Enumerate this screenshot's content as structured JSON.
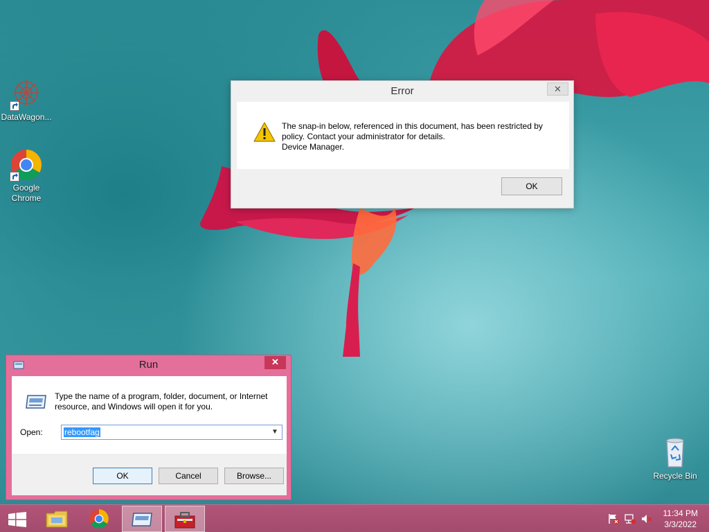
{
  "desktop": {
    "icons": [
      {
        "label": "DataWagon...",
        "icon": "datawagon-icon"
      },
      {
        "label": "Google Chrome",
        "icon": "chrome-icon"
      },
      {
        "label": "Recycle Bin",
        "icon": "recycle-bin-icon"
      }
    ]
  },
  "error_dialog": {
    "title": "Error",
    "close": "✕",
    "message_line1": "The snap-in below, referenced in this document, has been restricted by",
    "message_line2": "policy. Contact your administrator for details.",
    "message_line3": "Device Manager.",
    "ok_label": "OK",
    "icon": "warning-icon"
  },
  "run_dialog": {
    "title": "Run",
    "close": "✕",
    "description": "Type the name of a program, folder, document, or Internet resource, and Windows will open it for you.",
    "open_label": "Open:",
    "open_value": "rebootfag",
    "ok_label": "OK",
    "cancel_label": "Cancel",
    "browse_label": "Browse..."
  },
  "taskbar": {
    "items": [
      {
        "icon": "windows-logo-icon",
        "name": "start"
      },
      {
        "icon": "file-explorer-icon",
        "name": "File Explorer"
      },
      {
        "icon": "chrome-icon",
        "name": "Google Chrome"
      },
      {
        "icon": "run-icon",
        "name": "Run",
        "active": true
      },
      {
        "icon": "toolbox-icon",
        "name": "Toolbox"
      }
    ],
    "tray": {
      "icons": [
        "action-center-flag-icon",
        "network-icon",
        "volume-muted-icon"
      ],
      "time": "11:34 PM",
      "date": "3/3/2022"
    }
  },
  "colors": {
    "accent": "#e46f9b",
    "taskbar": "#a84f70",
    "selection": "#3399ff"
  }
}
